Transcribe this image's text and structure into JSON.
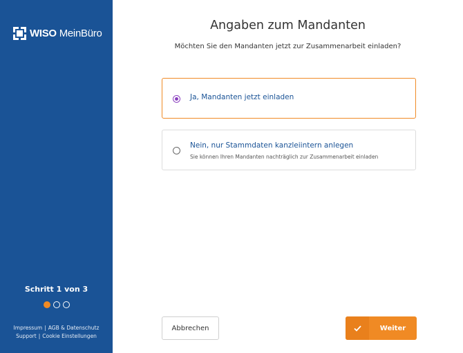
{
  "brand": {
    "name_bold": "WISO",
    "name_rest": "MeinBüro"
  },
  "progress": {
    "label": "Schritt 1 von 3",
    "current_step": 1,
    "total_steps": 3
  },
  "footer": {
    "impressum": "Impressum",
    "agb": "AGB & Datenschutz",
    "support": "Support",
    "cookies": "Cookie Einstellungen",
    "separator": "|"
  },
  "main": {
    "title": "Angaben zum Mandanten",
    "subtitle": "Möchten Sie den Mandanten jetzt zur Zusammenarbeit einladen?",
    "options": [
      {
        "label": "Ja, Mandanten jetzt einladen",
        "hint": "",
        "selected": true
      },
      {
        "label": "Nein, nur Stammdaten kanzleiintern anlegen",
        "hint": "Sie können Ihren Mandanten nachträglich zur Zusammenarbeit einladen",
        "selected": false
      }
    ]
  },
  "actions": {
    "cancel_label": "Abbrechen",
    "next_label": "Weiter"
  },
  "colors": {
    "sidebar": "#1a5396",
    "accent": "#f08a24",
    "radio": "#8a3fbf"
  }
}
